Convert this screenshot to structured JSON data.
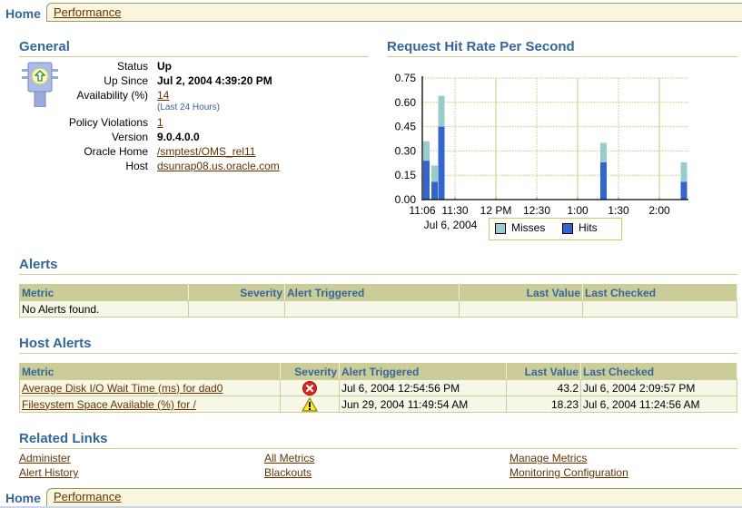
{
  "tabs": {
    "active": "Home",
    "other": "Performance"
  },
  "general": {
    "title": "General",
    "icon": "status-up-traffic-light-icon",
    "rows": [
      {
        "label": "Status",
        "value": "Up",
        "type": "bold"
      },
      {
        "label": "Up Since",
        "value": "Jul 2, 2004 4:39:20 PM",
        "type": "bold"
      },
      {
        "label": "Availability (%)",
        "value": "14",
        "type": "link",
        "note": "(Last 24 Hours)"
      },
      {
        "label": "Policy Violations",
        "value": "1",
        "type": "link"
      },
      {
        "label": "Version",
        "value": "9.0.4.0.0",
        "type": "bold"
      },
      {
        "label": "Oracle Home",
        "value": "/smptest/OMS_rel11",
        "type": "link"
      },
      {
        "label": "Host",
        "value": "dsunrap08.us.oracle.com",
        "type": "link"
      }
    ]
  },
  "chart_data": {
    "type": "bar",
    "stacked": true,
    "title": "Request Hit Rate Per Second",
    "xlabel": "",
    "ylabel": "",
    "ylim": [
      0,
      0.75
    ],
    "y_ticks": [
      "0.00",
      "0.15",
      "0.30",
      "0.45",
      "0.60",
      "0.75"
    ],
    "x_ticks": [
      "11:06",
      "11:30",
      "12 PM",
      "12:30",
      "1:00",
      "1:30",
      "2:00"
    ],
    "x_tick_minutes": [
      0,
      24,
      54,
      84,
      114,
      144,
      174
    ],
    "x_sublabel": "Jul 6, 2004",
    "grid": true,
    "legend_position": "bottom",
    "x_minutes": [
      3,
      9,
      14,
      133,
      192
    ],
    "series": [
      {
        "name": "Hits",
        "color": "#3366cc",
        "values": [
          0.24,
          0.11,
          0.45,
          0.23,
          0.11
        ]
      },
      {
        "name": "Misses",
        "color": "#99cccc",
        "values": [
          0.12,
          0.1,
          0.19,
          0.12,
          0.12
        ]
      }
    ],
    "legend": [
      {
        "name": "Misses",
        "color": "#99cccc"
      },
      {
        "name": "Hits",
        "color": "#3366cc"
      }
    ]
  },
  "alerts": {
    "title": "Alerts",
    "columns": [
      "Metric",
      "Severity",
      "Alert Triggered",
      "Last Value",
      "Last Checked"
    ],
    "empty_text": "No Alerts found."
  },
  "host_alerts": {
    "title": "Host Alerts",
    "columns": [
      "Metric",
      "Severity",
      "Alert Triggered",
      "Last Value",
      "Last Checked"
    ],
    "rows": [
      {
        "metric": "Average Disk I/O Wait Time (ms) for dad0",
        "severity": "critical-icon",
        "triggered": "Jul 6, 2004 12:54:56 PM",
        "last_value": "43.2",
        "last_checked": "Jul 6, 2004 2:09:57 PM"
      },
      {
        "metric": "Filesystem Space Available (%) for /",
        "severity": "warning-icon",
        "triggered": "Jun 29, 2004 11:49:54 AM",
        "last_value": "18.23",
        "last_checked": "Jul 6, 2004 11:24:56 AM"
      }
    ]
  },
  "related_links": {
    "title": "Related Links",
    "links": [
      "Administer",
      "Alert History",
      "All Metrics",
      "Blackouts",
      "Manage Metrics",
      "Monitoring Configuration"
    ]
  }
}
